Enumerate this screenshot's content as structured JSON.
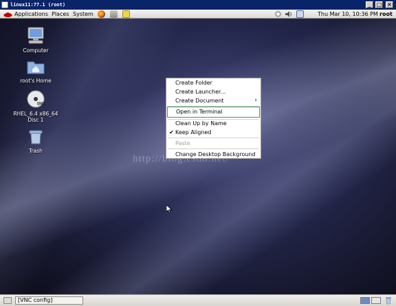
{
  "vnc_window": {
    "title": "linux11:77.1 (root)",
    "controls": {
      "minimize": "_",
      "maximize": "□",
      "close": "×"
    }
  },
  "top_panel": {
    "menus": [
      "Applications",
      "Places",
      "System"
    ],
    "clock": "Thu Mar 10, 10:36 PM",
    "user": "root",
    "launcher_icons": [
      "firefox-icon",
      "evolution-mail-icon",
      "notes-icon"
    ],
    "tray_icons": [
      "update-icon",
      "volume-icon",
      "network-icon"
    ]
  },
  "desktop_icons": [
    {
      "name": "computer",
      "label": "Computer"
    },
    {
      "name": "home",
      "label": "root's Home"
    },
    {
      "name": "disc",
      "label": "RHEL_6.4 x86_64\nDisc 1"
    },
    {
      "name": "trash",
      "label": "Trash"
    }
  ],
  "context_menu": {
    "items": [
      {
        "label": "Create Folder",
        "enabled": true
      },
      {
        "label": "Create Launcher...",
        "enabled": true
      },
      {
        "label": "Create Document",
        "enabled": true,
        "submenu": true
      },
      {
        "label": "Open in Terminal",
        "enabled": true,
        "highlighted": true
      },
      {
        "label": "Clean Up by Name",
        "enabled": true
      },
      {
        "label": "Keep Aligned",
        "enabled": true,
        "checked": true
      },
      {
        "label": "Paste",
        "enabled": false
      },
      {
        "label": "Change Desktop Background",
        "enabled": true
      }
    ]
  },
  "watermark": "http://blog.csdn.net/",
  "bottom_panel": {
    "task": "[VNC config]"
  },
  "colors": {
    "vnc_titlebar": "#0a246a",
    "panel": "#dcdad5",
    "menu_highlight_border": "#3c9a4e"
  }
}
